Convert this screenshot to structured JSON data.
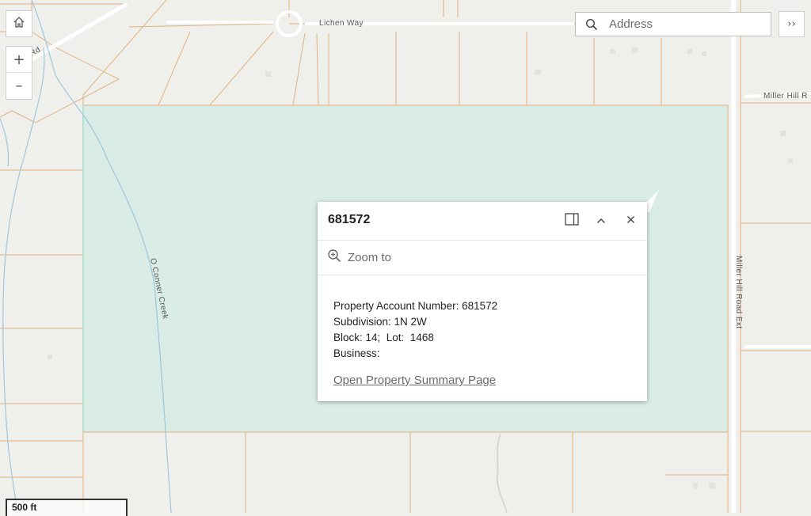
{
  "map": {
    "labels": {
      "lichen_way": "Lichen Way",
      "miller_hill_rd": "Miller Hill R",
      "miller_hill_road_ext": "Miller Hill Road Ext",
      "oconner_creek": "O Conner Creek",
      "rd_fragment": "Rd"
    },
    "colors": {
      "background": "#efefec",
      "parcel_line": "#e3b27d",
      "selection_fill": "#d9ece6",
      "selection_stroke": "#82d3c4",
      "creek": "#9cc8dc"
    }
  },
  "controls": {
    "home_icon": "home-icon",
    "zoom_in": "+",
    "zoom_out": "–"
  },
  "search": {
    "placeholder": "Address",
    "icon": "search-icon",
    "expand_label": "››"
  },
  "popup": {
    "title": "681572",
    "zoom_to": "Zoom to",
    "lines": [
      "Property Account Number: 681572",
      "Subdivision: 1N 2W",
      "Block: 14;  Lot:  1468",
      "Business:"
    ],
    "link": "Open Property Summary Page"
  },
  "scale": {
    "label": "500 ft"
  }
}
